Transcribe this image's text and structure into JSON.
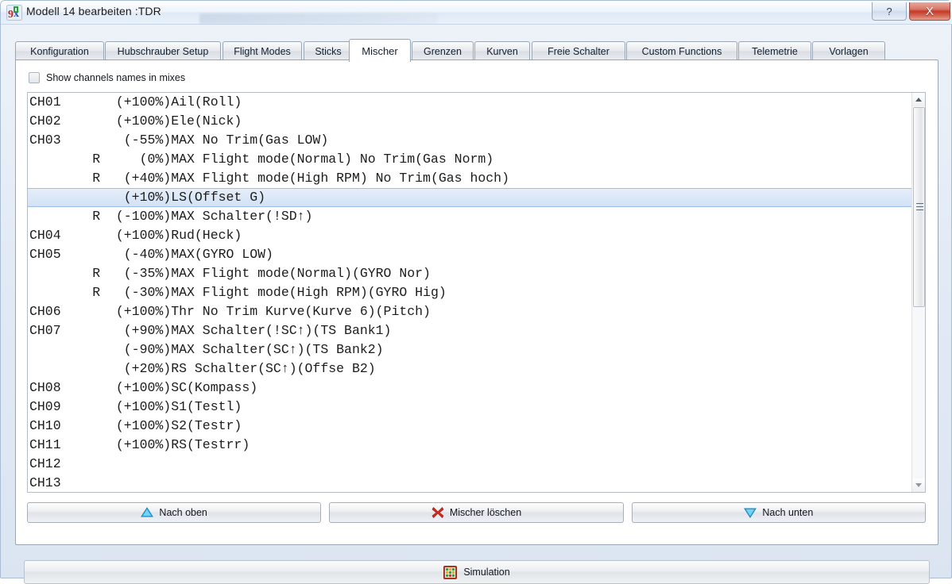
{
  "window": {
    "title": "Modell 14 bearbeiten :TDR",
    "app_icon": "9x-companion-icon",
    "buttons": {
      "help": "?",
      "close": "X"
    }
  },
  "tabs": [
    {
      "label": "Konfiguration",
      "active": false
    },
    {
      "label": "Hubschrauber Setup",
      "active": false
    },
    {
      "label": "Flight Modes",
      "active": false
    },
    {
      "label": "Sticks",
      "active": false
    },
    {
      "label": "Mischer",
      "active": true
    },
    {
      "label": "Grenzen",
      "active": false
    },
    {
      "label": "Kurven",
      "active": false
    },
    {
      "label": "Freie Schalter",
      "active": false
    },
    {
      "label": "Custom Functions",
      "active": false
    },
    {
      "label": "Telemetrie",
      "active": false
    },
    {
      "label": "Vorlagen",
      "active": false
    }
  ],
  "options": {
    "show_channel_names": {
      "label": "Show channels names in mixes",
      "checked": false
    }
  },
  "mix_list": {
    "selected_index": 5,
    "rows": [
      {
        "channel": "CH01",
        "flag": "",
        "percent": "(+100%)",
        "desc": "Ail(Roll)"
      },
      {
        "channel": "CH02",
        "flag": "",
        "percent": "(+100%)",
        "desc": "Ele(Nick)"
      },
      {
        "channel": "CH03",
        "flag": "",
        "percent": "(-55%)",
        "desc": "MAX No Trim(Gas LOW)"
      },
      {
        "channel": "",
        "flag": "R",
        "percent": "(0%)",
        "desc": "MAX Flight mode(Normal) No Trim(Gas Norm)"
      },
      {
        "channel": "",
        "flag": "R",
        "percent": "(+40%)",
        "desc": "MAX Flight mode(High RPM) No Trim(Gas hoch)"
      },
      {
        "channel": "",
        "flag": "",
        "percent": "(+10%)",
        "desc": "LS(Offset G)"
      },
      {
        "channel": "",
        "flag": "R",
        "percent": "(-100%)",
        "desc": "MAX Schalter(!SD↑)"
      },
      {
        "channel": "CH04",
        "flag": "",
        "percent": "(+100%)",
        "desc": "Rud(Heck)"
      },
      {
        "channel": "CH05",
        "flag": "",
        "percent": "(-40%)",
        "desc": "MAX(GYRO LOW)"
      },
      {
        "channel": "",
        "flag": "R",
        "percent": "(-35%)",
        "desc": "MAX Flight mode(Normal)(GYRO Nor)"
      },
      {
        "channel": "",
        "flag": "R",
        "percent": "(-30%)",
        "desc": "MAX Flight mode(High RPM)(GYRO Hig)"
      },
      {
        "channel": "CH06",
        "flag": "",
        "percent": "(+100%)",
        "desc": "Thr No Trim Kurve(Kurve 6)(Pitch)"
      },
      {
        "channel": "CH07",
        "flag": "",
        "percent": "(+90%)",
        "desc": "MAX Schalter(!SC↑)(TS Bank1)"
      },
      {
        "channel": "",
        "flag": "",
        "percent": "(-90%)",
        "desc": "MAX Schalter(SC↑)(TS Bank2)"
      },
      {
        "channel": "",
        "flag": "",
        "percent": "(+20%)",
        "desc": "RS Schalter(SC↑)(Offse B2)"
      },
      {
        "channel": "CH08",
        "flag": "",
        "percent": "(+100%)",
        "desc": "SC(Kompass)"
      },
      {
        "channel": "CH09",
        "flag": "",
        "percent": "(+100%)",
        "desc": "S1(Testl)"
      },
      {
        "channel": "CH10",
        "flag": "",
        "percent": "(+100%)",
        "desc": "S2(Testr)"
      },
      {
        "channel": "CH11",
        "flag": "",
        "percent": "(+100%)",
        "desc": "RS(Testrr)"
      },
      {
        "channel": "CH12",
        "flag": "",
        "percent": "",
        "desc": ""
      },
      {
        "channel": "CH13",
        "flag": "",
        "percent": "",
        "desc": ""
      }
    ]
  },
  "actions": {
    "move_up": {
      "label": "Nach oben",
      "icon": "triangle-up-icon"
    },
    "delete": {
      "label": "Mischer löschen",
      "icon": "red-x-icon"
    },
    "move_down": {
      "label": "Nach unten",
      "icon": "triangle-down-icon"
    },
    "simulate": {
      "label": "Simulation",
      "icon": "simulator-grid-icon"
    }
  },
  "colors": {
    "selection": "#d2e2f5",
    "selection_border": "#9dc0e4",
    "close_button": "#c4392a",
    "accent_blue": "#29a8e0"
  }
}
